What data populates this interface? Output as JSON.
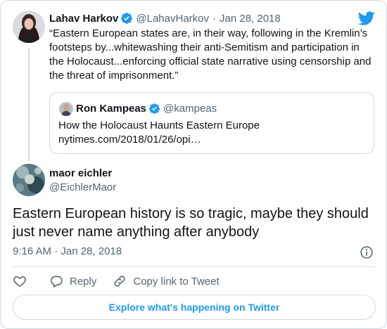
{
  "parent_tweet": {
    "name": "Lahav Harkov",
    "handle": "@LahavHarkov",
    "separator": "·",
    "date": "Jan 28, 2018",
    "text_lines": [
      "“Eastern European states are, in their way, following in the Kremlin’s",
      "footsteps by...whitewashing their anti-Semitism and participation in",
      "the Holocaust...enforcing official state narrative using censorship and",
      "the threat of imprisonment.”"
    ]
  },
  "quoted_tweet": {
    "name": "Ron Kampeas",
    "handle": "@kampeas",
    "lines": [
      "How the Holocaust Haunts Eastern Europe",
      "nytimes.com/2018/01/26/opi…"
    ]
  },
  "main_tweet": {
    "name": "maor eichler",
    "handle": "@EichlerMaor",
    "text_lines": [
      "Eastern European history is so tragic, maybe they should",
      "just never name anything after anybody"
    ],
    "timestamp": "9:16 AM · Jan 28, 2018"
  },
  "actions": {
    "reply_label": "Reply",
    "copy_link_label": "Copy link to Tweet"
  },
  "explore_label": "Explore what's happening on Twitter",
  "icons": {
    "brand": "twitter-bird-icon",
    "verified": "verified-badge-icon",
    "like": "heart-icon",
    "reply": "speech-bubble-icon",
    "copy_link": "link-icon",
    "info": "info-icon"
  },
  "colors": {
    "accent": "#1d9bf0",
    "text": "#0f1419",
    "muted": "#536471",
    "border": "#cfd9de"
  }
}
